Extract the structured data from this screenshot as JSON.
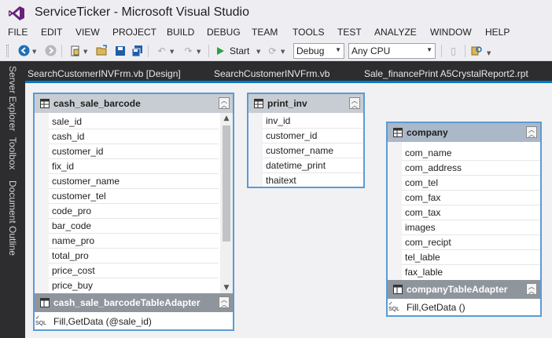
{
  "window": {
    "title": "ServiceTicker - Microsoft Visual Studio"
  },
  "menu": [
    "FILE",
    "EDIT",
    "VIEW",
    "PROJECT",
    "BUILD",
    "DEBUG",
    "TEAM",
    "TOOLS",
    "TEST",
    "ANALYZE",
    "WINDOW",
    "HELP"
  ],
  "toolbar": {
    "start_label": "Start",
    "configuration": "Debug",
    "platform": "Any CPU"
  },
  "left_strip": [
    "Server Explorer",
    "Toolbox",
    "Document Outline"
  ],
  "doc_tabs": [
    "SearchCustomerINVFrm.vb [Design]",
    "SearchCustomerINVFrm.vb",
    "Sale_financePrint A5CrystalReport2.rpt"
  ],
  "tables": {
    "cash_sale_barcode": {
      "title": "cash_sale_barcode",
      "columns": [
        "sale_id",
        "cash_id",
        "customer_id",
        "fix_id",
        "customer_name",
        "customer_tel",
        "code_pro",
        "bar_code",
        "name_pro",
        "total_pro",
        "price_cost",
        "price_buy"
      ],
      "adapter": "cash_sale_barcodeTableAdapter",
      "query": "Fill,GetData (@sale_id)"
    },
    "print_inv": {
      "title": "print_inv",
      "columns": [
        "inv_id",
        "customer_id",
        "customer_name",
        "datetime_print",
        "thaitext"
      ]
    },
    "company": {
      "title": "company",
      "columns": [
        "com_name",
        "com_address",
        "com_tel",
        "com_fax",
        "com_tax",
        "images",
        "com_recipt",
        "tel_lable",
        "fax_lable"
      ],
      "adapter": "companyTableAdapter",
      "query": "Fill,GetData ()"
    }
  },
  "sql_icon_text": "SQL",
  "colors": {
    "accent": "#007acc",
    "card_border": "#5b9bd5",
    "vs_purple": "#68217a",
    "start_green": "#2f9e44"
  },
  "icons": [
    "visual-studio-logo-icon",
    "back-icon",
    "forward-icon",
    "new-project-icon",
    "open-icon",
    "save-icon",
    "save-all-icon",
    "undo-icon",
    "redo-icon",
    "start-play-icon",
    "refresh-icon",
    "find-icon",
    "table-icon",
    "adapter-icon",
    "sql-query-icon",
    "collapse-icon"
  ]
}
